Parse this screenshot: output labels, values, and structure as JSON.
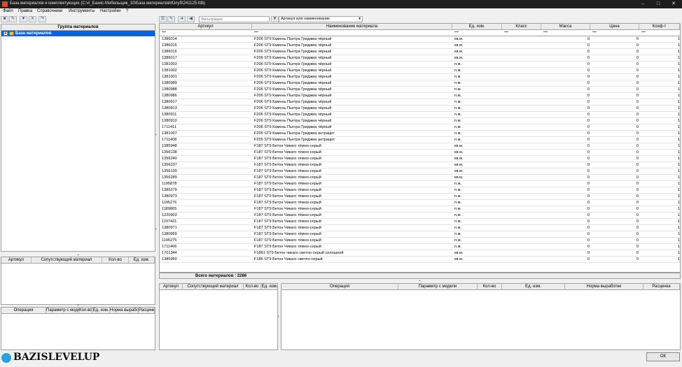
{
  "window": {
    "title": "База материалов и комплектующих   (C:\\#_Базис-Мебельщик_10\\База материалов\\Юлуб\\241125.fdb)"
  },
  "menu": [
    "Файл",
    "Правка",
    "Справочники",
    "Инструменты",
    "Настройки",
    "?"
  ],
  "toolbar": {
    "filter_placeholder": "Фильтрация",
    "filter_mode": "Артикул или наименование"
  },
  "left_tree": {
    "header": "Группа материалов",
    "root": "База материалов"
  },
  "left_mid": {
    "columns": [
      "Артикул",
      "Сопутствующий материал",
      "Кол-во",
      "Ед. изм."
    ]
  },
  "left_bottom": {
    "columns": [
      "Операция",
      "Параметр с моде",
      "Кол-во",
      "Ед. изм.",
      "Норма выработ",
      "Расценки"
    ]
  },
  "main": {
    "columns": [
      "Артикул",
      "Наименование материала",
      "Ед. изм.",
      "Класс",
      "Масса",
      "Цена",
      "Коэф-т"
    ],
    "rows": [
      [
        "1386014",
        "F206 ST9 Камень Пьетра Гриджиа чёрный",
        "кв.м.",
        "",
        "0",
        "0",
        "1"
      ],
      [
        "1386015",
        "F206 ST9 Камень Пьетра Гриджиа чёрный",
        "кв.м.",
        "",
        "0",
        "0",
        "1"
      ],
      [
        "1386016",
        "F206 ST9 Камень Пьетра Гриджиа чёрный",
        "кв.м.",
        "",
        "0",
        "0",
        "1"
      ],
      [
        "1386017",
        "F206 ST9 Камень Пьетра Гриджиа чёрный",
        "кв.м.",
        "",
        "0",
        "0",
        "1"
      ],
      [
        "1381003",
        "F206 ST9 Камень Пьетра Гриджиа чёрный",
        "п.м.",
        "",
        "0",
        "0",
        "1"
      ],
      [
        "1381002",
        "F206 ST9 Камень Пьетра Гриджиа чёрный",
        "п.м.",
        "",
        "0",
        "0",
        "1"
      ],
      [
        "1381001",
        "F206 ST9 Камень Пьетра Гриджиа чёрный",
        "п.м.",
        "",
        "0",
        "0",
        "1"
      ],
      [
        "1380989",
        "F206 ST9 Камень Пьетра Гриджиа чёрный",
        "п.м.",
        "",
        "0",
        "0",
        "1"
      ],
      [
        "1380988",
        "F206 ST9 Камень Пьетра Гриджиа чёрный",
        "п.м.",
        "",
        "0",
        "0",
        "1"
      ],
      [
        "1380986",
        "F206 ST9 Камень Пьетра Гриджиа чёрный",
        "п.м.",
        "",
        "0",
        "0",
        "1"
      ],
      [
        "1380917",
        "F206 ST9 Камень Пьетра Гриджиа чёрный",
        "п.м.",
        "",
        "0",
        "0",
        "1"
      ],
      [
        "1380913",
        "F206 ST9 Камень Пьетра Гриджиа чёрный",
        "п.м.",
        "",
        "0",
        "0",
        "1"
      ],
      [
        "1380911",
        "F206 ST9 Камень Пьетра Гриджиа чёрный",
        "п.м.",
        "",
        "0",
        "0",
        "1"
      ],
      [
        "1380910",
        "F206 ST9 Камень Пьетра Гриджиа чёрный",
        "п.м.",
        "",
        "0",
        "0",
        "1"
      ],
      [
        "1711411",
        "F206 ST9 Камень Пьетра Гриджиа чёрный",
        "п.м.",
        "",
        "0",
        "0",
        "1"
      ],
      [
        "1381007",
        "F205 ST9 Камень Пьетра Гриджиа антрацит",
        "п.м.",
        "",
        "0",
        "0",
        "1"
      ],
      [
        "1711408",
        "F205 ST9 Камень Пьетра Гриджиа антрацит",
        "п.м.",
        "",
        "0",
        "0",
        "1"
      ],
      [
        "1385948",
        "F187 ST9 Бетон Чикаго тёмно-серый",
        "кв.м.",
        "",
        "0",
        "0",
        "1"
      ],
      [
        "1356138",
        "F187 ST9 Бетон Чикаго тёмно-серый",
        "кв.м.",
        "",
        "0",
        "0",
        "1"
      ],
      [
        "1356240",
        "F187 ST9 Бетон Чикаго тёмно-серый",
        "кв.м.",
        "",
        "0",
        "0",
        "1"
      ],
      [
        "1356237",
        "F187 ST9 Бетон Чикаго тёмно-серый",
        "кв.м.",
        "",
        "0",
        "0",
        "1"
      ],
      [
        "1356139",
        "F187 ST9 Бетон Чикаго тёмно-серый",
        "кв.м.",
        "",
        "0",
        "0",
        "1"
      ],
      [
        "1356289",
        "F187 ST9 Бетон Чикаго тёмно-серый",
        "кв.м.",
        "",
        "0",
        "0",
        "1"
      ],
      [
        "1195878",
        "F187 ST9 Бетон Чикаго тёмно-серый",
        "п.м.",
        "",
        "0",
        "0",
        "1"
      ],
      [
        "1385279",
        "F187 ST9 Бетон Чикаго тёмно-серый",
        "п.м.",
        "",
        "0",
        "0",
        "1"
      ],
      [
        "1380973",
        "F187 ST9 Бетон Чикаго тёмно-серый",
        "п.м.",
        "",
        "0",
        "0",
        "1"
      ],
      [
        "1195276",
        "F187 ST9 Бетон Чикаго тёмно-серый",
        "п.м.",
        "",
        "0",
        "0",
        "1"
      ],
      [
        "1189865",
        "F187 ST9 Бетон Чикаго тёмно-серый",
        "п.м.",
        "",
        "0",
        "0",
        "1"
      ],
      [
        "1220903",
        "F187 ST9 Бетон Чикаго тёмно-серый",
        "п.м.",
        "",
        "0",
        "0",
        "1"
      ],
      [
        "1197431",
        "F187 ST9 Бетон Чикаго тёмно-серый",
        "п.м.",
        "",
        "0",
        "0",
        "1"
      ],
      [
        "1380971",
        "F187 ST9 Бетон Чикаго тёмно-серый",
        "п.м.",
        "",
        "0",
        "0",
        "1"
      ],
      [
        "1380959",
        "F187 ST9 Бетон Чикаго тёмно-серый",
        "п.м.",
        "",
        "0",
        "0",
        "1"
      ],
      [
        "1195275",
        "F187 ST9 Бетон Чикаго тёмно-серый",
        "п.м.",
        "",
        "0",
        "0",
        "1"
      ],
      [
        "1711406",
        "F187 ST9 Бетон Чикаго тёмно-серый",
        "п.м.",
        "",
        "0",
        "0",
        "1"
      ],
      [
        "1701344",
        "F1861 ST9 Бетон чикаго светло-серый сплошной",
        "кв.м.",
        "",
        "0",
        "0",
        "1"
      ],
      [
        "1385950",
        "F186 ST9 Бетон Чикаго светло-серый",
        "кв.м.",
        "",
        "0",
        "0",
        "1"
      ]
    ],
    "footer": "Всего материалов :  2286"
  },
  "bottom_left": {
    "columns": [
      "Артикул",
      "Сопутствующий материал",
      "Кол-во",
      "Ед. изм."
    ]
  },
  "bottom_right": {
    "columns": [
      "Операция",
      "Параметр с модели",
      "Кол-во",
      "Ед. изм.",
      "Норма выработки",
      "Расценка"
    ]
  },
  "footer": {
    "ok": "ОК"
  },
  "watermark": "BAZISLEVELUP"
}
